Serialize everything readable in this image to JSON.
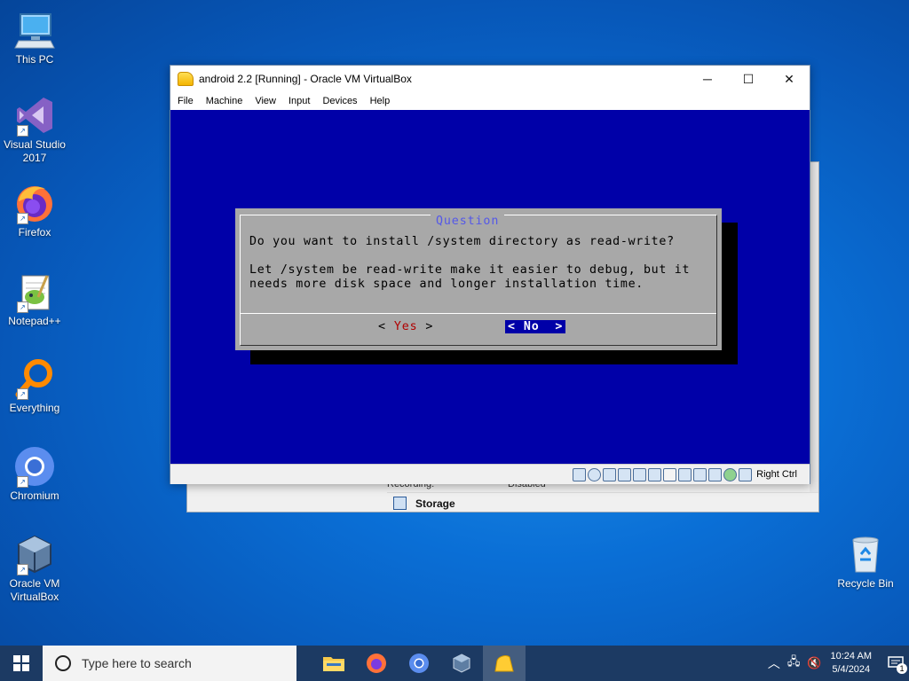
{
  "desktop": {
    "icons": [
      {
        "label": "This PC"
      },
      {
        "label": "Visual Studio 2017"
      },
      {
        "label": "Firefox"
      },
      {
        "label": "Notepad++"
      },
      {
        "label": "Everything"
      },
      {
        "label": "Chromium"
      },
      {
        "label": "Oracle VM VirtualBox"
      },
      {
        "label": "Recycle Bin"
      }
    ]
  },
  "manager": {
    "recording_label": "Recording:",
    "recording_value": "Disabled",
    "storage_label": "Storage"
  },
  "vm_window": {
    "title": "android 2.2 [Running] - Oracle VM VirtualBox",
    "menu": [
      "File",
      "Machine",
      "View",
      "Input",
      "Devices",
      "Help"
    ],
    "host_key": "Right Ctrl"
  },
  "dialog": {
    "title": "Question",
    "question": "Do you want to install /system directory as read-write?",
    "body_line1": "Let /system be read-write make it easier to debug, but it",
    "body_line2": "needs more disk space and longer installation time.",
    "yes_label": "Yes",
    "no_label": "No"
  },
  "taskbar": {
    "search_placeholder": "Type here to search",
    "time": "10:24 AM",
    "date": "5/4/2024",
    "notification_count": "1"
  },
  "colors": {
    "console_bg": "#0000a8",
    "dialog_bg": "#a8a8a8",
    "dialog_title": "#5458e8",
    "taskbar_bg": "#1c3a63"
  }
}
